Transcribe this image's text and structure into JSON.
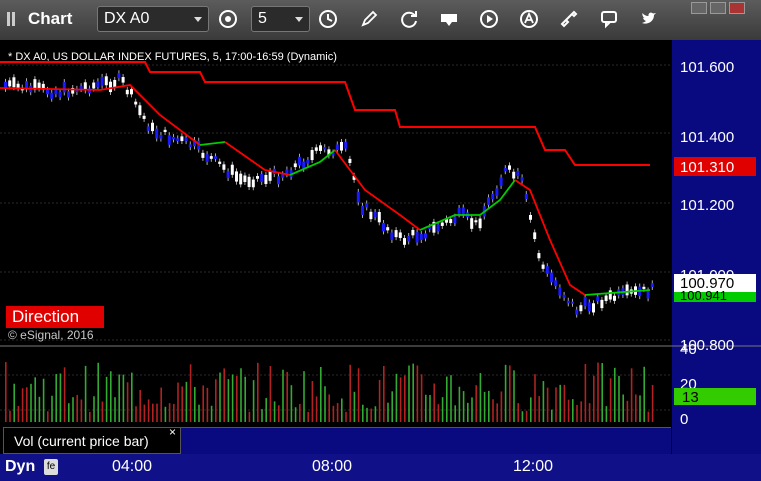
{
  "toolbar": {
    "app_title": "Chart",
    "symbol": "DX A0",
    "interval": "5",
    "icons": [
      "settings-gear-icon",
      "clock-icon",
      "pencil-icon",
      "refresh-cycle-icon",
      "get-icon",
      "play-icon",
      "alert-icon",
      "link-icon",
      "chat-icon",
      "twitter-icon"
    ],
    "window_buttons": [
      "min",
      "restore",
      "close"
    ]
  },
  "chart": {
    "title": "* DX A0, US DOLLAR INDEX FUTURES, 5, 17:00-16:59 (Dynamic)",
    "price_axis_ticks": [
      "101.600",
      "101.400",
      "101.200",
      "101.000",
      "100.800"
    ],
    "price_labels": {
      "red_line": {
        "text": "101.310",
        "color": "#e00000"
      },
      "last": {
        "text": "100.970",
        "color": "#ffffff"
      },
      "green_line": {
        "text": "100.941",
        "color": "#00cc00"
      }
    },
    "direction_badge": "Direction",
    "watermark": "© eSignal, 2016",
    "colors": {
      "up": "#ffffff",
      "down": "#1a1aff",
      "red_line": "#ff0000",
      "ma_up": "#00cc00",
      "ma_down": "#ff0000"
    }
  },
  "volume": {
    "tab_label": "Vol (current price bar)",
    "axis_ticks": [
      "40",
      "20",
      "0"
    ],
    "current_value": "13",
    "current_color": "#00cc00"
  },
  "bottom": {
    "dyn_label": "Dyn",
    "dyn_icon": "fe",
    "time_labels": [
      "04:00",
      "08:00",
      "12:00"
    ]
  }
}
